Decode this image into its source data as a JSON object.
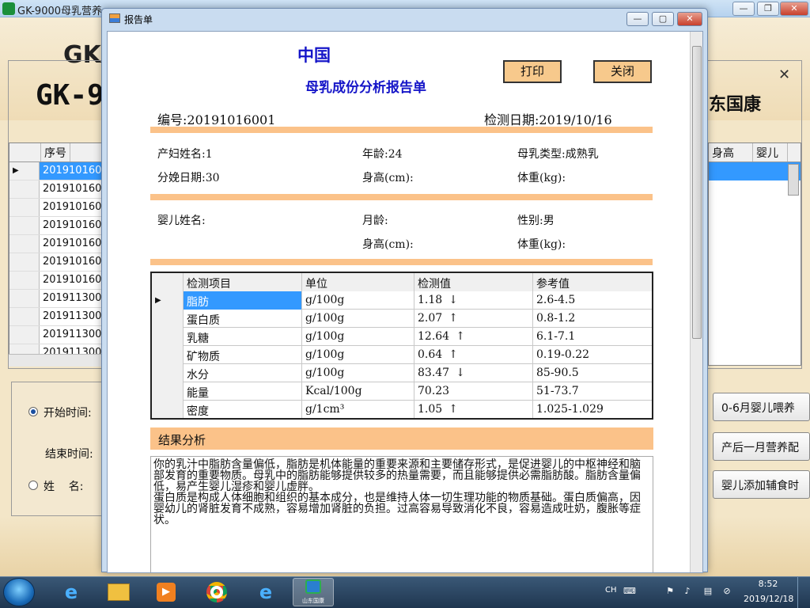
{
  "background_window": {
    "title": "GK-9000母乳营养",
    "banner_text": "GK-9",
    "banner_text_top": "GK",
    "company": "东国康",
    "grid": {
      "header": "序号",
      "rows": [
        "201910160",
        "201910160",
        "201910160",
        "201910160",
        "201910160",
        "201910160",
        "201910160",
        "201911300",
        "201911300",
        "201911300",
        "201911300"
      ],
      "right_headers": [
        "身高",
        "婴儿"
      ]
    },
    "filter": {
      "start_time_label": "开始时间:",
      "end_time_label": "结束时间:",
      "name_label": "姓    名:"
    },
    "side_buttons": [
      "0-6月婴儿喂养",
      "产后一月营养配",
      "婴儿添加辅食时"
    ]
  },
  "report_window": {
    "title": "报告单",
    "header": {
      "country": "中国",
      "report_title": "母乳成份分析报告单",
      "print_label": "打印",
      "close_label": "关闭"
    },
    "serial": {
      "label": "编号:",
      "value": "20191016001"
    },
    "test_date": {
      "label": "检测日期:",
      "value": "2019/10/16"
    },
    "mother": {
      "name": "产妇姓名:1",
      "age": "年龄:24",
      "milk_type": "母乳类型:成熟乳",
      "delivery_days": "分娩日期:30",
      "height": "身高(cm):",
      "weight": "体重(kg):"
    },
    "baby": {
      "name": "婴儿姓名:",
      "months": "月龄:",
      "gender": "性别:男",
      "height": "身高(cm):",
      "weight": "体重(kg):"
    },
    "table": {
      "headers": [
        "检测项目",
        "单位",
        "检测值",
        "参考值"
      ],
      "rows": [
        {
          "item": "脂肪",
          "unit": "g/100g",
          "value": "1.18",
          "arrow": "↓",
          "ref": "2.6-4.5"
        },
        {
          "item": "蛋白质",
          "unit": "g/100g",
          "value": "2.07",
          "arrow": "↑",
          "ref": "0.8-1.2"
        },
        {
          "item": "乳糖",
          "unit": "g/100g",
          "value": "12.64",
          "arrow": "↑",
          "ref": "6.1-7.1"
        },
        {
          "item": "矿物质",
          "unit": "g/100g",
          "value": "0.64",
          "arrow": "↑",
          "ref": "0.19-0.22"
        },
        {
          "item": "水分",
          "unit": "g/100g",
          "value": "83.47",
          "arrow": "↓",
          "ref": "85-90.5"
        },
        {
          "item": "能量",
          "unit": "Kcal/100g",
          "value": "70.23",
          "arrow": "",
          "ref": "51-73.7"
        },
        {
          "item": "密度",
          "unit": "g/1cm³",
          "value": "1.05",
          "arrow": "↑",
          "ref": "1.025-1.029"
        }
      ]
    },
    "analysis": {
      "heading": "结果分析",
      "paragraphs": [
        "你的乳汁中脂肪含量偏低，脂肪是机体能量的重要来源和主要储存形式，是促进婴儿的中枢神经和脑部发育的重要物质。母乳中的脂肪能够提供较多的热量需要，而且能够提供必需脂肪酸。脂肪含量偏低，易产生婴儿湿疹和婴儿虚胖。",
        "蛋白质是构成人体细胞和组织的基本成分，也是维持人体一切生理功能的物质基础。蛋白质偏高，因婴幼儿的肾脏发育不成熟，容易增加肾脏的负担。过高容易导致消化不良，容易造成吐奶，腹胀等症状。"
      ]
    }
  },
  "taskbar": {
    "lang": "CH",
    "time": "8:52",
    "date": "2019/12/18",
    "active_app": "山东国康"
  }
}
